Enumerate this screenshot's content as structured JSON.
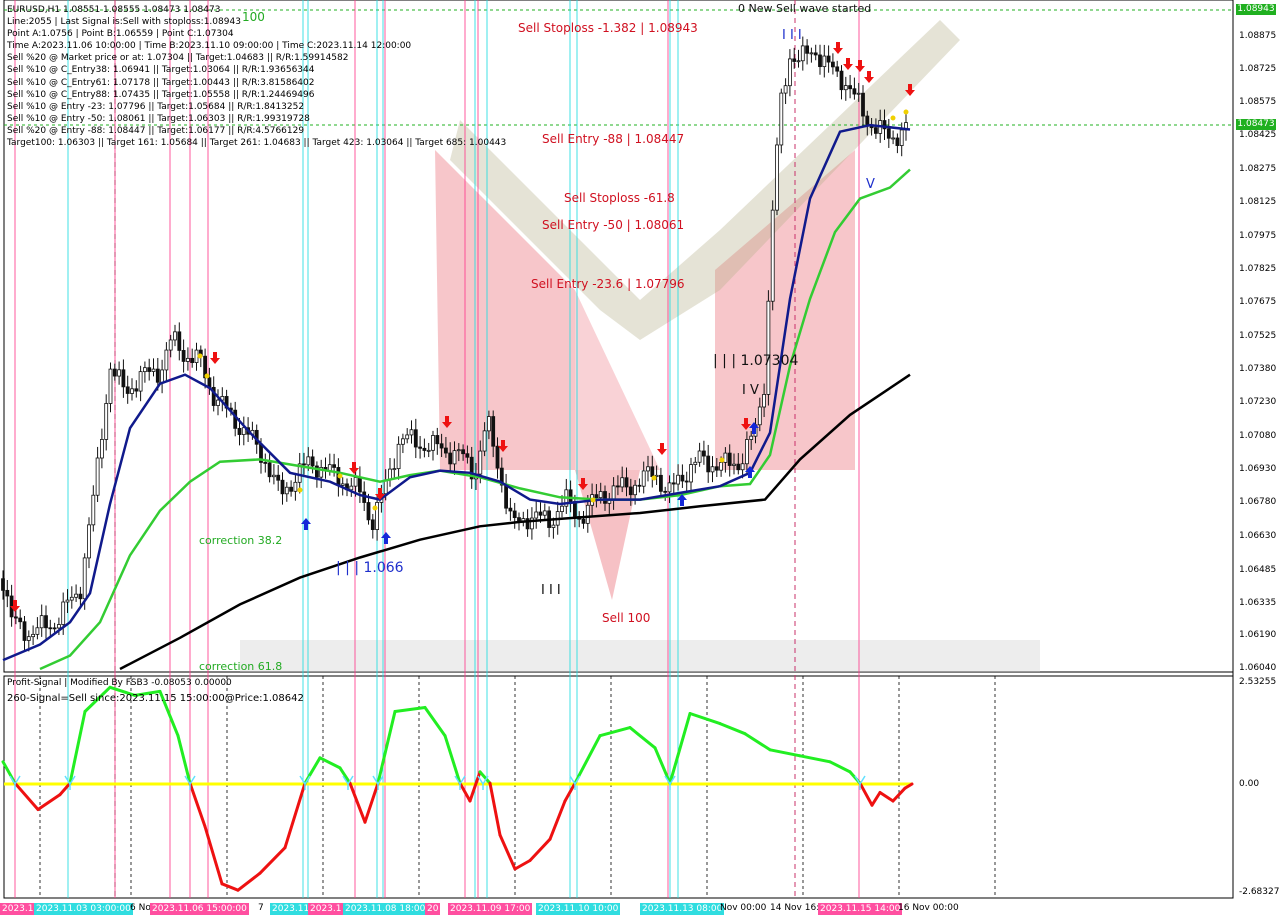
{
  "window": {
    "symbol_line": "EURUSD,H1  1.08551 1.08555 1.08473 1.08473",
    "info_lines": [
      "Line:2055 | Last Signal is:Sell with stoploss:1.08943",
      "Point A:1.0756 | Point B:1.06559 | Point C:1.07304",
      "Time A:2023.11.06 10:00:00 | Time B:2023.11.10 09:00:00 | Time C:2023.11.14 12:00:00",
      "Sell %20 @ Market price or at: 1.07304 || Target:1.04683 || R/R:1.59914582",
      "Sell %10 @ C_Entry38: 1.06941 || Target:1.03064 || R/R:1.93656344",
      "Sell %10 @ C_Entry61: 1.07178 || Target:1.00443 || R/R:3.81586402",
      "Sell %10 @ C_Entry88: 1.07435 || Target:1.05558 || R/R:1.24469496",
      "Sell %10 @ Entry -23: 1.07796 || Target:1.05684 || R/R:1.8413252",
      "Sell %10 @ Entry -50: 1.08061 || Target:1.06303 || R/R:1.99319728",
      "Sell %20 @ Entry -88: 1.08447 || Target:1.06177 || R/R:4.5766129",
      "Target100: 1.06303 || Target 161: 1.05684 || Target 261: 1.04683 || Target 423: 1.03064 || Target 685: 1.00443"
    ]
  },
  "labels": {
    "top_100": "100",
    "new_wave": "0 New Sell wave started",
    "sell_stoploss_1382": "Sell Stoploss -1.382 | 1.08943",
    "sell_entry_88": "Sell Entry -88 | 1.08447",
    "sell_stoploss_618": "Sell Stoploss -61.8",
    "sell_entry_50": "Sell Entry -50 | 1.08061",
    "sell_entry_236": "Sell Entry -23.6 | 1.07796",
    "level_c": "| | | 1.07304",
    "level_b": "| | | 1.066",
    "wave_iv": "I V",
    "wave_iii_top": "I I I",
    "wave_iii_bottom": "I I I",
    "wave_v": "V",
    "sell_100": "Sell 100",
    "correction_382": "correction 38.2",
    "correction_618": "correction 61.8",
    "r_a": "R/R:4"
  },
  "price_axis": {
    "ticks": [
      "1.08875",
      "1.08725",
      "1.08575",
      "1.08425",
      "1.08275",
      "1.08125",
      "1.07975",
      "1.07825",
      "1.07675",
      "1.07525",
      "1.07380",
      "1.07230",
      "1.07080",
      "1.06930",
      "1.06780",
      "1.06630",
      "1.06485",
      "1.06335",
      "1.06190",
      "1.06040"
    ],
    "stoploss_box": "1.08943",
    "current_box": "1.08473"
  },
  "indicator": {
    "title": "Profit-Signal | Modified By FSB3 -0.08053 0.00000",
    "signal": "260-Signal=Sell since:2023.11.15 15:00:00@Price:1.08642",
    "ticks": [
      "2.53255",
      "0.00",
      "-2.68327"
    ]
  },
  "time_axis": {
    "labels": [
      {
        "text": "2023.11.02",
        "hl": "pink"
      },
      {
        "text": "2023.11.03 03:00:00",
        "hl": "cyan"
      },
      {
        "text": "6 No",
        "hl": "none"
      },
      {
        "text": "2023.11.06 15:00:00",
        "hl": "pink"
      },
      {
        "text": "7",
        "hl": "none"
      },
      {
        "text": "2023.11",
        "hl": "cyan"
      },
      {
        "text": "2023.1",
        "hl": "pink"
      },
      {
        "text": "2023.11.08 18:00",
        "hl": "cyan"
      },
      {
        "text": "20",
        "hl": "pink"
      },
      {
        "text": "2023.11.09 17:00",
        "hl": "pink"
      },
      {
        "text": "2023.11.10 10:00",
        "hl": "cyan"
      },
      {
        "text": "Nov",
        "hl": "none"
      },
      {
        "text": "2023.11.13 08:00",
        "hl": "cyan"
      },
      {
        "text": "Nov 00:00",
        "hl": "none"
      },
      {
        "text": "14 Nov 16:0",
        "hl": "none"
      },
      {
        "text": "2023.11.15 14:00",
        "hl": "pink"
      },
      {
        "text": "16 Nov 00:00",
        "hl": "none"
      }
    ]
  },
  "colors": {
    "candle": "#111111",
    "ma_fast": "#101a8c",
    "ma_mid": "#33cc33",
    "ma_slow": "#000000",
    "vline_pink": "#ff3c8c",
    "vline_cyan": "#22dde0",
    "signal_up": "#22ee22",
    "signal_down": "#ee1111",
    "zero_line": "#ffff00",
    "sell_arrow": "#ee1111",
    "buy_arrow": "#1428d8"
  },
  "chart_data": {
    "type": "candlestick",
    "symbol": "EURUSD",
    "timeframe": "H1",
    "ylim": [
      1.0604,
      1.0897
    ],
    "levels": {
      "stoploss": 1.08943,
      "entry_88": 1.08447,
      "entry_50": 1.08061,
      "entry_236": 1.07796,
      "point_c": 1.07304,
      "point_b": 1.066,
      "current": 1.08473
    },
    "close_path": [
      [
        0,
        1.0651
      ],
      [
        12,
        1.0625
      ],
      [
        30,
        1.062
      ],
      [
        55,
        1.0625
      ],
      [
        80,
        1.064
      ],
      [
        95,
        1.0685
      ],
      [
        110,
        1.074
      ],
      [
        125,
        1.0728
      ],
      [
        140,
        1.0735
      ],
      [
        160,
        1.0738
      ],
      [
        172,
        1.0752
      ],
      [
        185,
        1.0745
      ],
      [
        200,
        1.0742
      ],
      [
        212,
        1.0728
      ],
      [
        230,
        1.0718
      ],
      [
        250,
        1.0708
      ],
      [
        265,
        1.0698
      ],
      [
        280,
        1.0682
      ],
      [
        295,
        1.069
      ],
      [
        310,
        1.0697
      ],
      [
        330,
        1.0692
      ],
      [
        345,
        1.0688
      ],
      [
        360,
        1.0683
      ],
      [
        372,
        1.067
      ],
      [
        385,
        1.0685
      ],
      [
        400,
        1.0708
      ],
      [
        420,
        1.0705
      ],
      [
        440,
        1.0703
      ],
      [
        460,
        1.07
      ],
      [
        475,
        1.0692
      ],
      [
        487,
        1.0715
      ],
      [
        500,
        1.0692
      ],
      [
        512,
        1.0668
      ],
      [
        530,
        1.0673
      ],
      [
        550,
        1.067
      ],
      [
        565,
        1.068
      ],
      [
        580,
        1.0672
      ],
      [
        600,
        1.0682
      ],
      [
        620,
        1.0685
      ],
      [
        640,
        1.0688
      ],
      [
        655,
        1.0693
      ],
      [
        668,
        1.0682
      ],
      [
        680,
        1.069
      ],
      [
        700,
        1.0698
      ],
      [
        720,
        1.0695
      ],
      [
        740,
        1.0697
      ],
      [
        755,
        1.071
      ],
      [
        765,
        1.0735
      ],
      [
        772,
        1.0805
      ],
      [
        780,
        1.0855
      ],
      [
        790,
        1.088
      ],
      [
        800,
        1.0877
      ],
      [
        815,
        1.0882
      ],
      [
        830,
        1.0873
      ],
      [
        845,
        1.0868
      ],
      [
        855,
        1.086
      ],
      [
        865,
        1.0852
      ],
      [
        875,
        1.0847
      ],
      [
        890,
        1.0842
      ],
      [
        900,
        1.0845
      ],
      [
        910,
        1.0847
      ]
    ],
    "ma_fast": [
      [
        3,
        1.0608
      ],
      [
        40,
        1.0615
      ],
      [
        70,
        1.0625
      ],
      [
        90,
        1.0638
      ],
      [
        110,
        1.0678
      ],
      [
        130,
        1.0712
      ],
      [
        160,
        1.0732
      ],
      [
        185,
        1.0736
      ],
      [
        210,
        1.073
      ],
      [
        250,
        1.071
      ],
      [
        290,
        1.0692
      ],
      [
        330,
        1.0688
      ],
      [
        360,
        1.0682
      ],
      [
        380,
        1.068
      ],
      [
        410,
        1.069
      ],
      [
        440,
        1.0693
      ],
      [
        470,
        1.0692
      ],
      [
        500,
        1.0688
      ],
      [
        530,
        1.068
      ],
      [
        560,
        1.0678
      ],
      [
        600,
        1.068
      ],
      [
        640,
        1.068
      ],
      [
        680,
        1.0683
      ],
      [
        720,
        1.0686
      ],
      [
        750,
        1.0692
      ],
      [
        770,
        1.071
      ],
      [
        790,
        1.077
      ],
      [
        810,
        1.0815
      ],
      [
        840,
        1.0845
      ],
      [
        870,
        1.0848
      ],
      [
        910,
        1.0846
      ]
    ],
    "ma_mid": [
      [
        40,
        1.0604
      ],
      [
        70,
        1.061
      ],
      [
        100,
        1.0625
      ],
      [
        130,
        1.0655
      ],
      [
        160,
        1.0675
      ],
      [
        190,
        1.0688
      ],
      [
        220,
        1.0697
      ],
      [
        260,
        1.0698
      ],
      [
        300,
        1.0695
      ],
      [
        340,
        1.0692
      ],
      [
        380,
        1.0688
      ],
      [
        410,
        1.0691
      ],
      [
        440,
        1.0693
      ],
      [
        480,
        1.069
      ],
      [
        520,
        1.0685
      ],
      [
        560,
        1.0681
      ],
      [
        600,
        1.068
      ],
      [
        640,
        1.068
      ],
      [
        680,
        1.0682
      ],
      [
        720,
        1.0686
      ],
      [
        750,
        1.0687
      ],
      [
        770,
        1.07
      ],
      [
        790,
        1.074
      ],
      [
        810,
        1.077
      ],
      [
        835,
        1.08
      ],
      [
        860,
        1.0815
      ],
      [
        890,
        1.082
      ],
      [
        910,
        1.0828
      ]
    ],
    "ma_slow": [
      [
        120,
        1.0604
      ],
      [
        180,
        1.0618
      ],
      [
        240,
        1.0633
      ],
      [
        300,
        1.0645
      ],
      [
        360,
        1.0654
      ],
      [
        420,
        1.0662
      ],
      [
        480,
        1.0668
      ],
      [
        520,
        1.067
      ],
      [
        580,
        1.0672
      ],
      [
        640,
        1.0674
      ],
      [
        700,
        1.0677
      ],
      [
        765,
        1.068
      ],
      [
        800,
        1.0698
      ],
      [
        850,
        1.0718
      ],
      [
        880,
        1.0727
      ],
      [
        910,
        1.0736
      ]
    ],
    "indicator_series": [
      [
        3,
        0.55
      ],
      [
        15,
        0.02
      ],
      [
        38,
        -0.6
      ],
      [
        60,
        -0.25
      ],
      [
        70,
        0.02
      ],
      [
        85,
        1.8
      ],
      [
        110,
        2.4
      ],
      [
        135,
        2.2
      ],
      [
        160,
        2.3
      ],
      [
        178,
        1.2
      ],
      [
        190,
        0.02
      ],
      [
        205,
        -1.0
      ],
      [
        222,
        -2.35
      ],
      [
        238,
        -2.5
      ],
      [
        260,
        -2.1
      ],
      [
        285,
        -1.5
      ],
      [
        305,
        0.02
      ],
      [
        320,
        0.65
      ],
      [
        340,
        0.4
      ],
      [
        350,
        0.02
      ],
      [
        365,
        -0.9
      ],
      [
        378,
        0.02
      ],
      [
        395,
        1.8
      ],
      [
        425,
        1.9
      ],
      [
        445,
        1.2
      ],
      [
        460,
        0.02
      ],
      [
        470,
        -0.4
      ],
      [
        480,
        0.3
      ],
      [
        490,
        0.02
      ],
      [
        500,
        -1.2
      ],
      [
        515,
        -2.0
      ],
      [
        530,
        -1.8
      ],
      [
        550,
        -1.3
      ],
      [
        565,
        -0.4
      ],
      [
        575,
        0.02
      ],
      [
        600,
        1.2
      ],
      [
        630,
        1.4
      ],
      [
        655,
        0.9
      ],
      [
        670,
        0.02
      ],
      [
        690,
        1.75
      ],
      [
        720,
        1.5
      ],
      [
        745,
        1.25
      ],
      [
        770,
        0.85
      ],
      [
        800,
        0.7
      ],
      [
        830,
        0.55
      ],
      [
        850,
        0.3
      ],
      [
        860,
        0.02
      ],
      [
        872,
        -0.5
      ],
      [
        880,
        -0.2
      ],
      [
        893,
        -0.4
      ],
      [
        905,
        -0.1
      ],
      [
        912,
        0.0
      ]
    ],
    "indicator_ylim": [
      -2.68327,
      2.53255
    ]
  }
}
